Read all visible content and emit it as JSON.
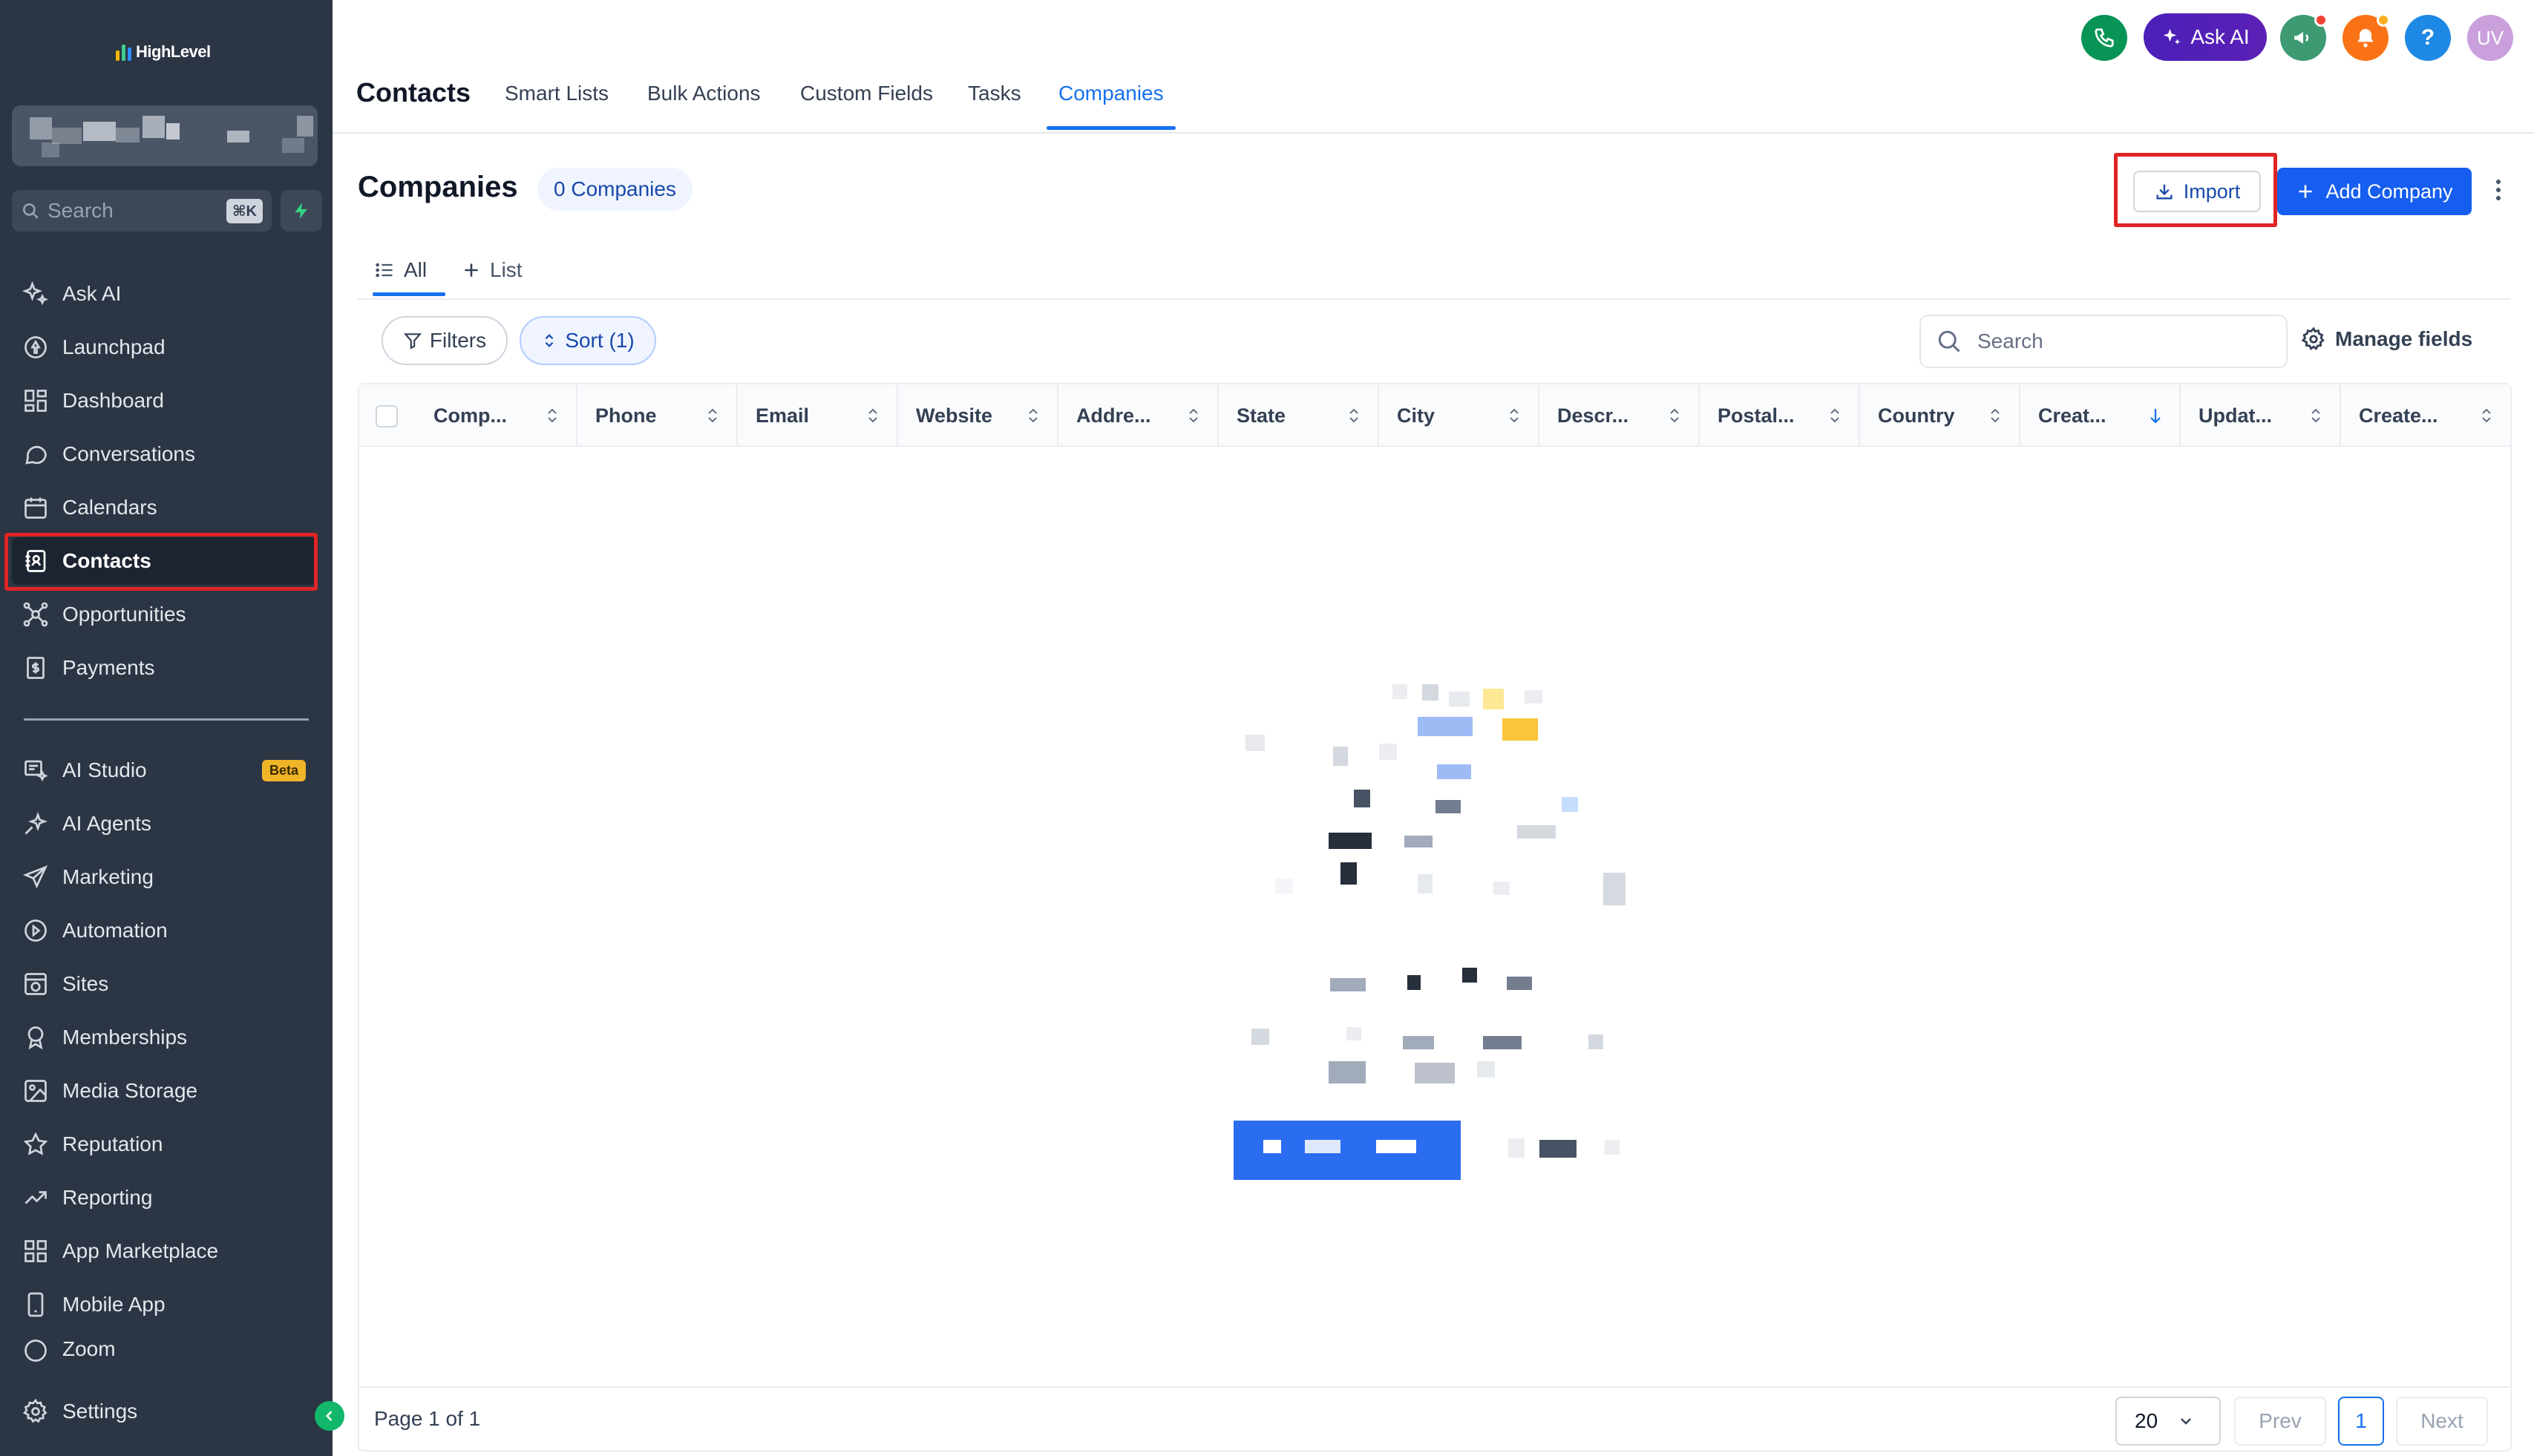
{
  "brand": {
    "name": "HighLevel"
  },
  "account": {
    "name": ""
  },
  "sidebar": {
    "search_placeholder": "Search",
    "search_shortcut": "⌘K",
    "items": [
      {
        "label": "Ask AI",
        "icon": "sparkles-icon"
      },
      {
        "label": "Launchpad",
        "icon": "rocket-icon"
      },
      {
        "label": "Dashboard",
        "icon": "grid-icon"
      },
      {
        "label": "Conversations",
        "icon": "chat-bubble-icon"
      },
      {
        "label": "Calendars",
        "icon": "calendar-icon"
      },
      {
        "label": "Contacts",
        "icon": "contact-card-icon",
        "active": true
      },
      {
        "label": "Opportunities",
        "icon": "network-icon"
      },
      {
        "label": "Payments",
        "icon": "receipt-icon"
      }
    ],
    "items2": [
      {
        "label": "AI Studio",
        "icon": "ai-studio-icon",
        "badge": "Beta"
      },
      {
        "label": "AI Agents",
        "icon": "sparkles-icon"
      },
      {
        "label": "Marketing",
        "icon": "send-icon"
      },
      {
        "label": "Automation",
        "icon": "automation-icon"
      },
      {
        "label": "Sites",
        "icon": "globe-icon"
      },
      {
        "label": "Memberships",
        "icon": "award-icon"
      },
      {
        "label": "Media Storage",
        "icon": "image-icon"
      },
      {
        "label": "Reputation",
        "icon": "star-icon"
      },
      {
        "label": "Reporting",
        "icon": "trend-icon"
      },
      {
        "label": "App Marketplace",
        "icon": "grid-icon"
      },
      {
        "label": "Mobile App",
        "icon": "phone-device-icon"
      },
      {
        "label": "Zoom",
        "icon": "zoom-icon"
      }
    ],
    "settings_label": "Settings"
  },
  "topnav": {
    "module_title": "Contacts",
    "tabs": [
      "Smart Lists",
      "Bulk Actions",
      "Custom Fields",
      "Tasks",
      "Companies"
    ],
    "active_tab": "Companies",
    "ask_ai_label": "Ask AI",
    "avatar_initials": "UV",
    "help_label": "?"
  },
  "page": {
    "title": "Companies",
    "count_badge": "0 Companies",
    "import_label": "Import",
    "add_label": "Add Company"
  },
  "views": {
    "all_label": "All",
    "add_list_label": "List"
  },
  "filters": {
    "filters_label": "Filters",
    "sort_label": "Sort (1)",
    "search_placeholder": "Search",
    "manage_fields_label": "Manage fields"
  },
  "table": {
    "columns": [
      "Comp...",
      "Phone",
      "Email",
      "Website",
      "Addre...",
      "State",
      "City",
      "Descr...",
      "Postal...",
      "Country",
      "Creat...",
      "Updat...",
      "Create..."
    ],
    "rows": []
  },
  "pagination": {
    "page_info": "Page 1 of 1",
    "per_page": "20",
    "prev_label": "Prev",
    "current_page": "1",
    "next_label": "Next"
  },
  "colors": {
    "sidebar_bg": "#2b3544",
    "accent_blue": "#155eef",
    "highlight_red": "#e02424",
    "ask_ai_purple": "#4a1fb8"
  }
}
